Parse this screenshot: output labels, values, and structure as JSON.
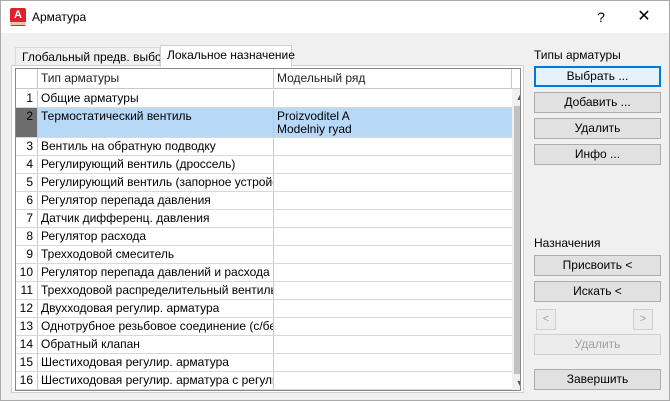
{
  "window": {
    "title": "Арматура",
    "app_icon_letter": "A",
    "help_glyph": "?",
    "close_glyph": "✕"
  },
  "tabs": [
    {
      "label": "Глобальный предв. выбор",
      "active": false
    },
    {
      "label": "Локальное назначение",
      "active": true
    }
  ],
  "grid": {
    "headers": [
      "Тип арматуры",
      "Модельный ряд"
    ],
    "rows": [
      {
        "n": "1",
        "type": "Общие арматуры",
        "model": ""
      },
      {
        "n": "2",
        "type": "Термостатический вентиль",
        "model": "Proizvoditel A\nModelniy ryad",
        "selected": true
      },
      {
        "n": "3",
        "type": "Вентиль на обратную подводку",
        "model": ""
      },
      {
        "n": "4",
        "type": "Регулирующий вентиль (дроссель)",
        "model": ""
      },
      {
        "n": "5",
        "type": "Регулирующий вентиль (запорное устройст...",
        "model": ""
      },
      {
        "n": "6",
        "type": "Регулятор перепада давления",
        "model": ""
      },
      {
        "n": "7",
        "type": "Датчик дифференц. давления",
        "model": ""
      },
      {
        "n": "8",
        "type": "Регулятор расхода",
        "model": ""
      },
      {
        "n": "9",
        "type": "Трехходовой смеситель",
        "model": ""
      },
      {
        "n": "10",
        "type": "Регулятор перепада давлений и расхода",
        "model": ""
      },
      {
        "n": "11",
        "type": "Трехходовой распределительный вентиль",
        "model": ""
      },
      {
        "n": "12",
        "type": "Двухходовая регулир. арматура",
        "model": ""
      },
      {
        "n": "13",
        "type": "Однотрубное резьбовое соединение (с/без ...",
        "model": ""
      },
      {
        "n": "14",
        "type": "Обратный клапан",
        "model": ""
      },
      {
        "n": "15",
        "type": "Шестиходовая регулир. арматура",
        "model": ""
      },
      {
        "n": "16",
        "type": "Шестиходовая регулир. арматура с регулир...",
        "model": ""
      }
    ]
  },
  "scroll": {
    "up_glyph": "▲",
    "down_glyph": "▼"
  },
  "side": {
    "types_label": "Типы арматуры",
    "select": "Выбрать ...",
    "add": "Добавить ...",
    "delete": "Удалить",
    "info": "Инфо ...",
    "assign_label": "Назначения",
    "assign": "Присвоить  <",
    "search": "Искать <",
    "prev_glyph": "<",
    "next_glyph": ">",
    "delete_assign": "Удалить",
    "finish": "Завершить"
  }
}
